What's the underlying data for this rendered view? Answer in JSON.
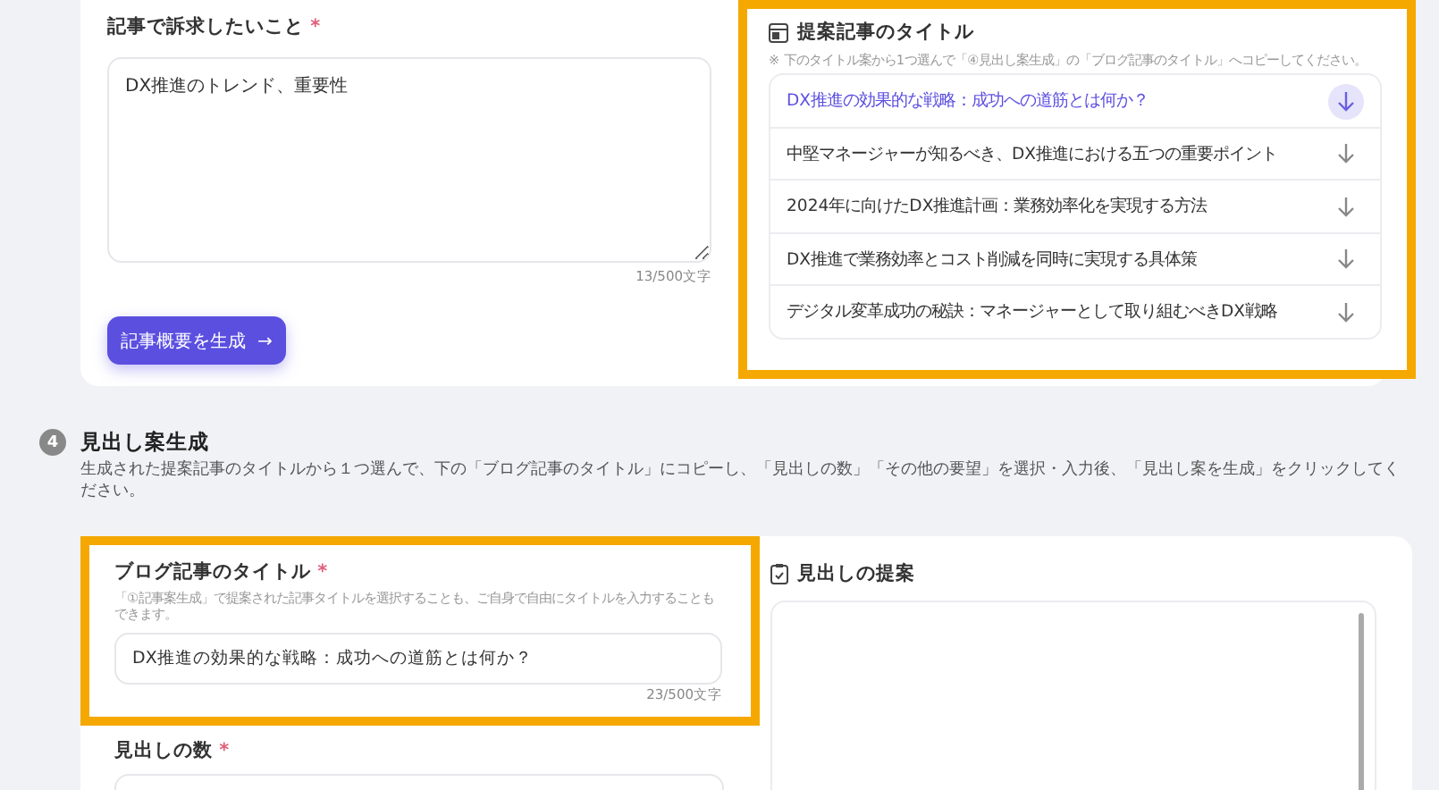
{
  "appeal": {
    "label": "記事で訴求したいこと",
    "required_mark": "*",
    "value": "DX推進のトレンド、重要性",
    "counter": "13/500文字"
  },
  "generate_button": {
    "label": "記事概要を生成",
    "arrow": "→"
  },
  "suggested_titles": {
    "highlighted": true,
    "title": "提案記事のタイトル",
    "note": "※ 下のタイトル案から1つ選んで「④見出し案生成」の「ブログ記事のタイトル」へコピーしてください。",
    "items": [
      {
        "text": "DX推進の効果的な戦略：成功への道筋とは何か？",
        "selected": true
      },
      {
        "text": "中堅マネージャーが知るべき、DX推進における五つの重要ポイント",
        "selected": false
      },
      {
        "text": "2024年に向けたDX推進計画：業務効率化を実現する方法",
        "selected": false
      },
      {
        "text": "DX推進で業務効率とコスト削減を同時に実現する具体策",
        "selected": false
      },
      {
        "text": "デジタル変革成功の秘訣：マネージャーとして取り組むべきDX戦略",
        "selected": false
      }
    ]
  },
  "section": {
    "number": "4",
    "title": "見出し案生成",
    "description": "生成された提案記事のタイトルから１つ選んで、下の「ブログ記事のタイトル」にコピーし、「見出しの数」「その他の要望」を選択・入力後、「見出し案を生成」をクリックしてください。"
  },
  "blog_title": {
    "highlighted": true,
    "label": "ブログ記事のタイトル",
    "required_mark": "*",
    "hint": "「①記事案生成」で提案された記事タイトルを選択することも、ご自身で自由にタイトルを入力することもできます。",
    "value": "DX推進の効果的な戦略：成功への道筋とは何か？",
    "counter": "23/500文字"
  },
  "heading_count": {
    "label": "見出しの数",
    "required_mark": "*"
  },
  "heading_suggestions": {
    "title": "見出しの提案"
  }
}
